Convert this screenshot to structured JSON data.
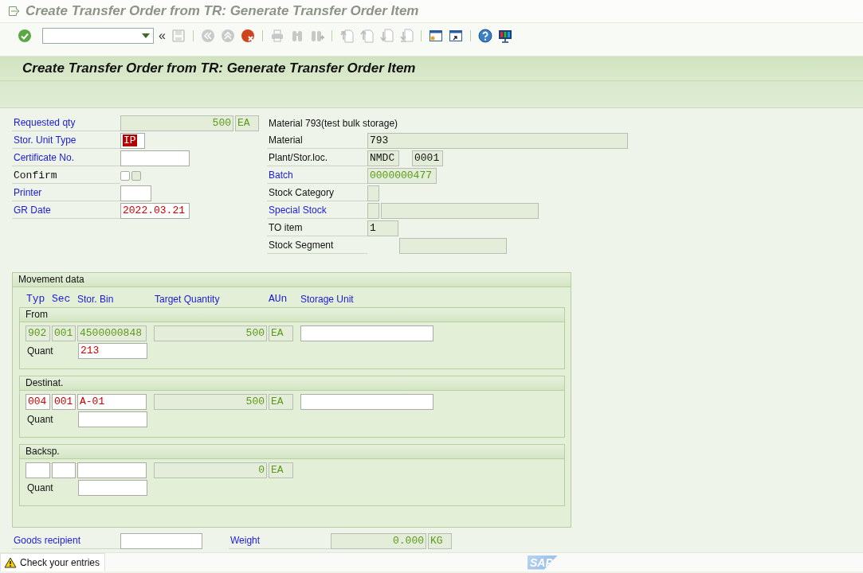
{
  "title_bar": {
    "title": "Create Transfer Order from TR: Generate Transfer Order Item"
  },
  "toolbar": {
    "enter": {
      "disabled": false
    },
    "collapse": "«",
    "groups": [
      [
        {
          "kind": "save",
          "disabled": true
        }
      ],
      [
        {
          "kind": "back",
          "disabled": true
        },
        {
          "kind": "exit",
          "disabled": true
        },
        {
          "kind": "cancel",
          "disabled": false
        }
      ],
      [
        {
          "kind": "print",
          "disabled": true
        },
        {
          "kind": "find",
          "disabled": true
        },
        {
          "kind": "find-next",
          "disabled": true
        }
      ],
      [
        {
          "kind": "first-page",
          "disabled": true
        },
        {
          "kind": "prev-page",
          "disabled": true
        },
        {
          "kind": "next-page",
          "disabled": true
        },
        {
          "kind": "last-page",
          "disabled": true
        }
      ],
      [
        {
          "kind": "new-session",
          "disabled": false
        },
        {
          "kind": "shortcut",
          "disabled": false
        }
      ],
      [
        {
          "kind": "help",
          "disabled": false
        },
        {
          "kind": "layout",
          "disabled": false
        }
      ]
    ]
  },
  "header": {
    "title": "Create Transfer Order from TR: Generate Transfer Order Item"
  },
  "left_fields": [
    {
      "label": "Requested qty",
      "kind": "link",
      "fields": [
        {
          "value": "500",
          "editable": false,
          "kind": "fetched"
        },
        {
          "value": "EA",
          "editable": false,
          "kind": "fetched"
        }
      ]
    },
    {
      "label": "Stor. Unit Type",
      "kind": "link",
      "fields": [
        {
          "value": "IP",
          "editable": true,
          "kind": "highlight"
        }
      ]
    },
    {
      "label": "Certificate No.",
      "kind": "link",
      "fields": [
        {
          "editable": true
        }
      ]
    },
    {
      "label": "Confirm",
      "kind": "mono",
      "checkboxes": [
        {
          "checked": false,
          "kind": "input"
        },
        {
          "checked": false,
          "kind": "display"
        }
      ]
    },
    {
      "label": "Printer",
      "kind": "link",
      "fields": [
        {
          "editable": true
        }
      ]
    },
    {
      "label": "GR Date",
      "kind": "link",
      "fields": [
        {
          "value": "2022.03.21",
          "editable": true,
          "kind": "entered"
        }
      ]
    }
  ],
  "material_description": "Material 793(test bulk storage)",
  "right_fields": [
    {
      "label": "Material",
      "kind": "plain",
      "fields": [
        {
          "value": "793",
          "editable": false,
          "kind": "plain"
        }
      ]
    },
    {
      "label": "Plant/Stor.loc.",
      "kind": "plain",
      "fields": [
        {
          "value": "NMDC",
          "editable": false,
          "kind": "plain"
        },
        {
          "value": "0001",
          "editable": false,
          "kind": "plain"
        }
      ]
    },
    {
      "label": "Batch",
      "kind": "link",
      "fields": [
        {
          "value": "0000000477",
          "editable": false,
          "kind": "fetched"
        }
      ]
    },
    {
      "label": "Stock Category",
      "kind": "plain",
      "fields": [
        {
          "editable": false
        }
      ]
    },
    {
      "label": "Special Stock",
      "kind": "link",
      "fields": [
        {
          "editable": false
        },
        {
          "editable": false
        }
      ]
    },
    {
      "label": "TO item",
      "kind": "plain",
      "fields": [
        {
          "value": "1",
          "editable": false,
          "kind": "plain"
        }
      ]
    },
    {
      "label": "Stock Segment",
      "kind": "plain",
      "fields": [
        {
          "editable": false
        }
      ]
    }
  ],
  "movement": {
    "title": "Movement data",
    "columns": [
      {
        "label": "Typ",
        "kind": "code"
      },
      {
        "label": "Sec",
        "kind": "code"
      },
      {
        "label": "Stor. Bin",
        "kind": "link"
      },
      {
        "label": "Target Quantity",
        "kind": "link"
      },
      {
        "label": "AUn",
        "kind": "code"
      },
      {
        "label": "Storage Unit",
        "kind": "link"
      }
    ],
    "groups": [
      {
        "title": "From",
        "fields": [
          {
            "value": "902",
            "editable": false,
            "kind": "fetched"
          },
          {
            "value": "001",
            "editable": false,
            "kind": "fetched"
          },
          {
            "value": "4500000848",
            "editable": false,
            "kind": "fetched"
          },
          {
            "value": "500",
            "editable": false,
            "kind": "fetched"
          },
          {
            "value": "EA",
            "editable": false,
            "kind": "fetched"
          },
          {
            "editable": true
          }
        ],
        "quant": {
          "label": "Quant",
          "field": {
            "value": "213",
            "editable": true,
            "kind": "entered"
          }
        }
      },
      {
        "title": "Destinat.",
        "fields": [
          {
            "value": "004",
            "editable": true,
            "kind": "entered"
          },
          {
            "value": "001",
            "editable": true,
            "kind": "entered"
          },
          {
            "value": "A-01",
            "editable": true,
            "kind": "entered"
          },
          {
            "value": "500",
            "editable": false,
            "kind": "fetched"
          },
          {
            "value": "EA",
            "editable": false,
            "kind": "fetched"
          },
          {
            "editable": true
          }
        ],
        "quant": {
          "label": "Quant",
          "field": {
            "editable": true
          }
        }
      },
      {
        "title": "Backsp.",
        "fields": [
          {
            "editable": true
          },
          {
            "editable": true
          },
          {
            "editable": true
          },
          {
            "value": "0",
            "editable": false,
            "kind": "fetched"
          },
          {
            "value": "EA",
            "editable": false,
            "kind": "fetched"
          }
        ],
        "quant": {
          "label": "Quant",
          "field": {
            "editable": true
          }
        }
      }
    ]
  },
  "bottom_fields": [
    {
      "label": "Goods recipient",
      "kind": "link",
      "fields": [
        {
          "editable": true
        }
      ]
    },
    {
      "label": "Weight",
      "kind": "link",
      "fields": [
        {
          "value": "0.000",
          "editable": false,
          "kind": "fetched"
        },
        {
          "value": "KG",
          "editable": false,
          "kind": "fetched"
        }
      ]
    }
  ],
  "status_bar": {
    "kind": "warning",
    "message": "Check your entries",
    "logo": "SAP"
  }
}
